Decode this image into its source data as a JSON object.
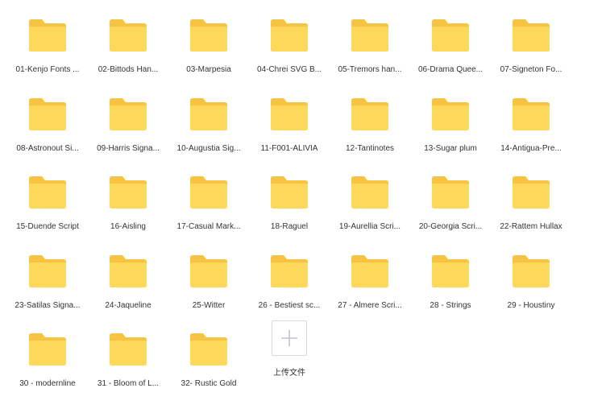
{
  "colors": {
    "folder_back": "#F6C343",
    "folder_front": "#FDD85A",
    "label_text": "#333333",
    "upload_border": "#D5D8DC",
    "upload_plus": "#C0C4CC"
  },
  "folders": [
    {
      "label": "01-Kenjo Fonts ...",
      "icon": "folder-icon"
    },
    {
      "label": "02-Bittods Han...",
      "icon": "folder-icon"
    },
    {
      "label": "03-Marpesia",
      "icon": "folder-icon"
    },
    {
      "label": "04-Chrei SVG B...",
      "icon": "folder-icon"
    },
    {
      "label": "05-Tremors han...",
      "icon": "folder-icon"
    },
    {
      "label": "06-Drama Quee...",
      "icon": "folder-icon"
    },
    {
      "label": "07-Signeton Fo...",
      "icon": "folder-icon"
    },
    {
      "label": "08-Astronout Si...",
      "icon": "folder-icon"
    },
    {
      "label": "09-Harris Signa...",
      "icon": "folder-icon"
    },
    {
      "label": "10-Augustia Sig...",
      "icon": "folder-icon"
    },
    {
      "label": "11-F001-ALIVIA",
      "icon": "folder-icon"
    },
    {
      "label": "12-Tantinotes",
      "icon": "folder-icon"
    },
    {
      "label": "13-Sugar plum",
      "icon": "folder-icon"
    },
    {
      "label": "14-Antigua-Pre...",
      "icon": "folder-icon"
    },
    {
      "label": "15-Duende Script",
      "icon": "folder-icon"
    },
    {
      "label": "16-Aisling",
      "icon": "folder-icon"
    },
    {
      "label": "17-Casual Mark...",
      "icon": "folder-icon"
    },
    {
      "label": "18-Raguel",
      "icon": "folder-icon"
    },
    {
      "label": "19-Aurellia Scri...",
      "icon": "folder-icon"
    },
    {
      "label": "20-Georgia Scri...",
      "icon": "folder-icon"
    },
    {
      "label": "22-Rattem Hullax",
      "icon": "folder-icon"
    },
    {
      "label": "23-Satilas Signa...",
      "icon": "folder-icon"
    },
    {
      "label": "24-Jaqueline",
      "icon": "folder-icon"
    },
    {
      "label": "25-Witter",
      "icon": "folder-icon"
    },
    {
      "label": "26 - Bestiest sc...",
      "icon": "folder-icon"
    },
    {
      "label": "27 - Almere Scri...",
      "icon": "folder-icon"
    },
    {
      "label": "28 - Strings",
      "icon": "folder-icon"
    },
    {
      "label": "29 - Houstiny",
      "icon": "folder-icon"
    },
    {
      "label": "30 - modernline",
      "icon": "folder-icon"
    },
    {
      "label": "31 - Bloom of L...",
      "icon": "folder-icon"
    },
    {
      "label": "32- Rustic Gold",
      "icon": "folder-icon"
    }
  ],
  "upload": {
    "label": "上传文件",
    "icon": "plus-icon"
  }
}
